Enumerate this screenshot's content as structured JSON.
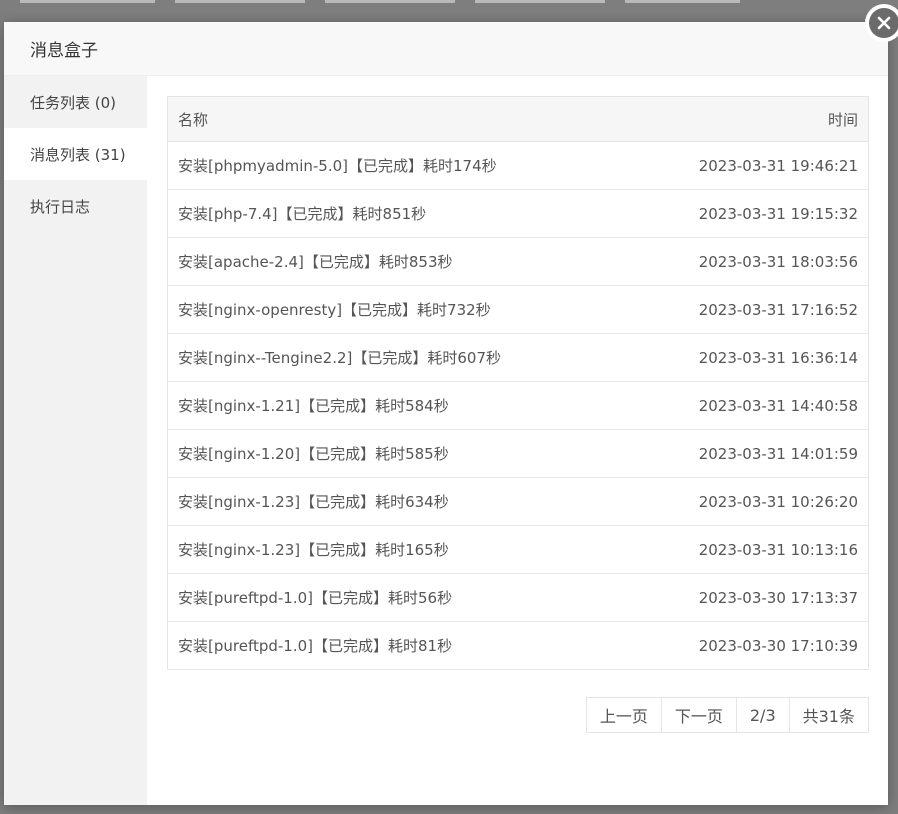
{
  "modal": {
    "title": "消息盒子"
  },
  "sidebar": {
    "items": [
      {
        "label": "任务列表 (0)"
      },
      {
        "label": "消息列表 (31)"
      },
      {
        "label": "执行日志"
      }
    ]
  },
  "table": {
    "headers": {
      "name": "名称",
      "time": "时间"
    },
    "rows": [
      {
        "name": "安装[phpmyadmin-5.0]【已完成】耗时174秒",
        "time": "2023-03-31 19:46:21"
      },
      {
        "name": "安装[php-7.4]【已完成】耗时851秒",
        "time": "2023-03-31 19:15:32"
      },
      {
        "name": "安装[apache-2.4]【已完成】耗时853秒",
        "time": "2023-03-31 18:03:56"
      },
      {
        "name": "安装[nginx-openresty]【已完成】耗时732秒",
        "time": "2023-03-31 17:16:52"
      },
      {
        "name": "安装[nginx--Tengine2.2]【已完成】耗时607秒",
        "time": "2023-03-31 16:36:14"
      },
      {
        "name": "安装[nginx-1.21]【已完成】耗时584秒",
        "time": "2023-03-31 14:40:58"
      },
      {
        "name": "安装[nginx-1.20]【已完成】耗时585秒",
        "time": "2023-03-31 14:01:59"
      },
      {
        "name": "安装[nginx-1.23]【已完成】耗时634秒",
        "time": "2023-03-31 10:26:20"
      },
      {
        "name": "安装[nginx-1.23]【已完成】耗时165秒",
        "time": "2023-03-31 10:13:16"
      },
      {
        "name": "安装[pureftpd-1.0]【已完成】耗时56秒",
        "time": "2023-03-30 17:13:37"
      },
      {
        "name": "安装[pureftpd-1.0]【已完成】耗时81秒",
        "time": "2023-03-30 17:10:39"
      }
    ]
  },
  "pager": {
    "prev": "上一页",
    "next": "下一页",
    "page": "2/3",
    "total": "共31条"
  }
}
